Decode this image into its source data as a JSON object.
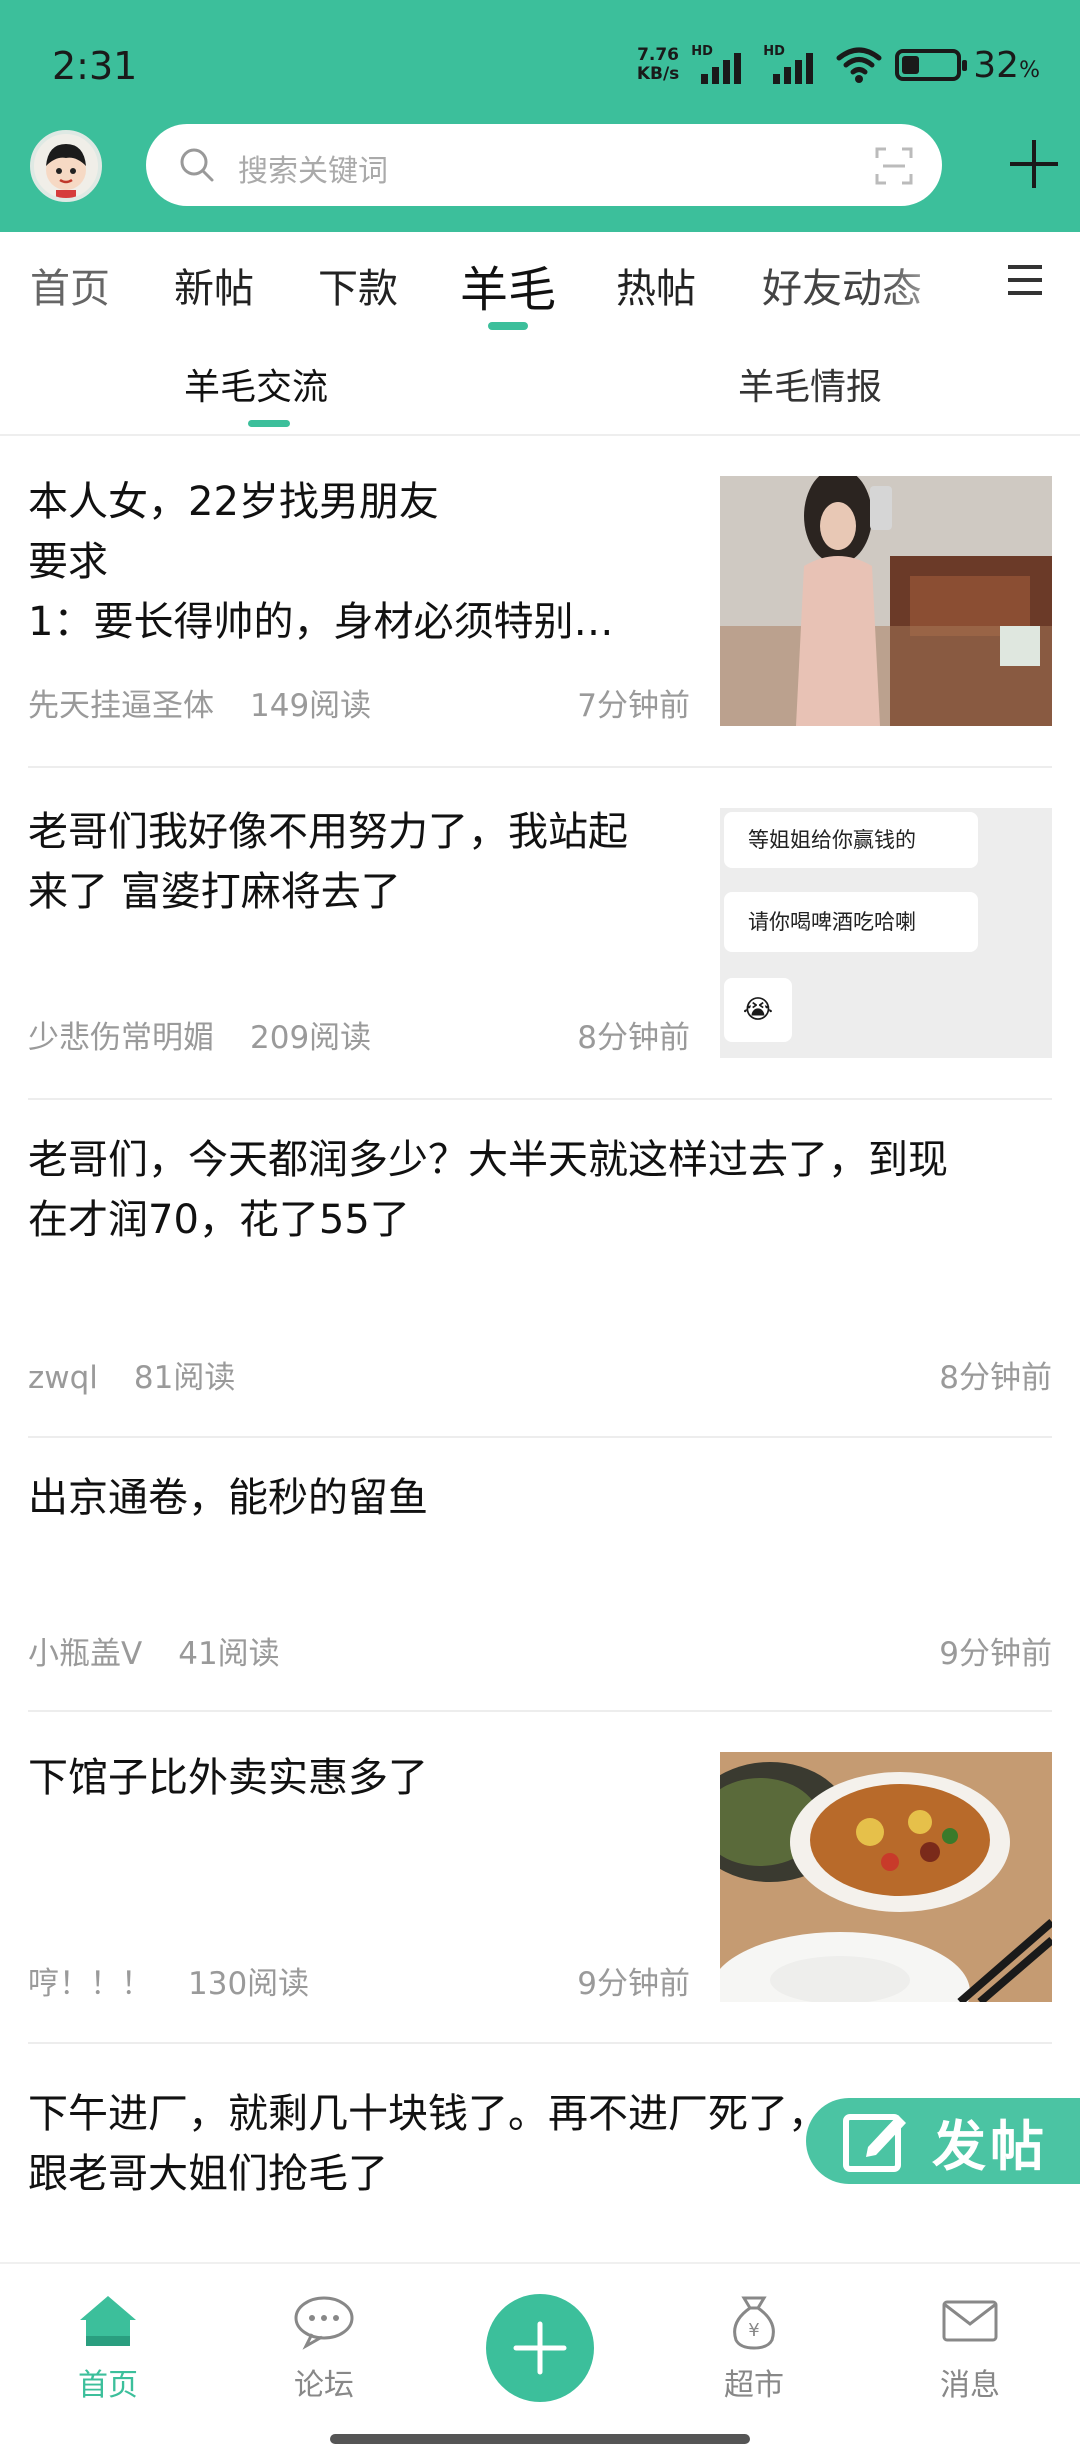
{
  "status": {
    "time": "2:31",
    "net_speed_top": "7.76",
    "net_speed_bottom": "KB/s",
    "sim_tag": "HD",
    "battery_percent": "32",
    "battery_unit": "%",
    "battery_level": 0.32
  },
  "search": {
    "placeholder": "搜索关键词"
  },
  "tabs": [
    "首页",
    "新帖",
    "下款",
    "羊毛",
    "热帖",
    "好友动态"
  ],
  "active_tab": "羊毛",
  "subtabs": [
    "羊毛交流",
    "羊毛情报"
  ],
  "active_subtab": "羊毛交流",
  "posts": [
    {
      "title_lines": [
        "本人女，22岁找男朋友",
        "要求",
        "1：要长得帅的，身材必须特别…"
      ],
      "author": "先天挂逼圣体",
      "reads": "149阅读",
      "time": "7分钟前",
      "has_image": true,
      "image": "woman-selfie"
    },
    {
      "title_lines": [
        "老哥们我好像不用努力了，我站起",
        "来了 富婆打麻将去了"
      ],
      "author": "少悲伤常明媚",
      "reads": "209阅读",
      "time": "8分钟前",
      "has_image": true,
      "image": "chat-screenshot",
      "image_texts": [
        "等姐姐给你赢钱的",
        "请你喝啤酒吃哈喇",
        "😭"
      ]
    },
    {
      "title_lines": [
        "老哥们，今天都润多少？大半天就这样过去了，到现",
        "在才润70，花了55了"
      ],
      "author": "zwql",
      "reads": "81阅读",
      "time": "8分钟前",
      "has_image": false
    },
    {
      "title_lines": [
        "出京通卷，能秒的留鱼"
      ],
      "author": "小瓶盖V",
      "reads": "41阅读",
      "time": "9分钟前",
      "has_image": false
    },
    {
      "title_lines": [
        "下馆子比外卖实惠多了"
      ],
      "author": "哼！！！",
      "reads": "130阅读",
      "time": "9分钟前",
      "has_image": true,
      "image": "food-dishes"
    },
    {
      "title_lines": [
        "下午进厂，就剩几十块钱了。再不进厂死了，",
        "跟老哥大姐们抢毛了"
      ],
      "author": "",
      "reads": "",
      "time": "",
      "has_image": false
    }
  ],
  "fab": {
    "label": "发帖"
  },
  "bottom_nav": [
    "首页",
    "论坛",
    "超市",
    "消息"
  ],
  "active_bottom": "首页",
  "colors": {
    "accent": "#3cbf9b",
    "meta_gray": "#9a9a9a"
  }
}
